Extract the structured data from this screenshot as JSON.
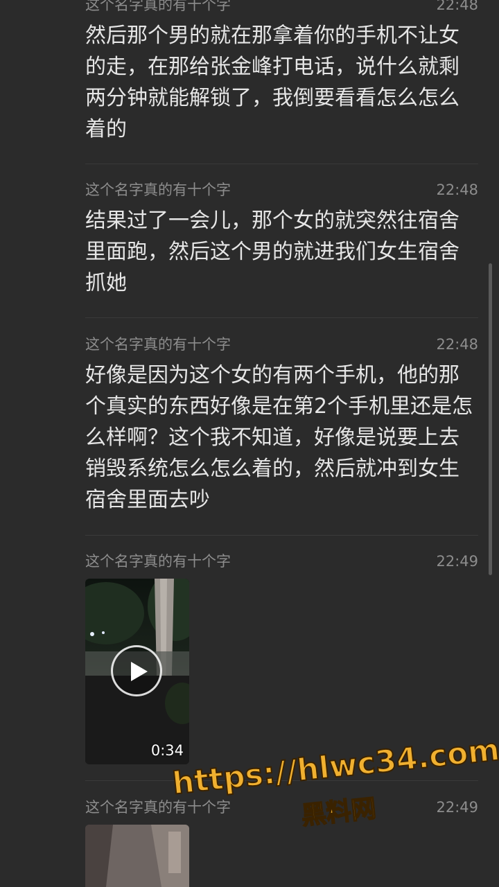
{
  "messages": [
    {
      "sender": "这个名字真的有十个字",
      "time": "22:48",
      "text": "然后那个男的就在那拿着你的手机不让女的走，在那给张金峰打电话，说什么就剩两分钟就能解锁了，我倒要看看怎么怎么着的"
    },
    {
      "sender": "这个名字真的有十个字",
      "time": "22:48",
      "text": "结果过了一会儿，那个女的就突然往宿舍里面跑，然后这个男的就进我们女生宿舍抓她"
    },
    {
      "sender": "这个名字真的有十个字",
      "time": "22:48",
      "text": "好像是因为这个女的有两个手机，他的那个真实的东西好像是在第2个手机里还是怎么样啊？这个我不知道，好像是说要上去销毁系统怎么怎么着的，然后就冲到女生宿舍里面去吵"
    },
    {
      "sender": "这个名字真的有十个字",
      "time": "22:49",
      "video": {
        "duration": "0:34",
        "icon": "play-icon"
      }
    },
    {
      "sender": "这个名字真的有十个字",
      "time": "22:49",
      "video": {
        "icon": "image-thumbnail"
      }
    }
  ],
  "watermark": {
    "url": "https://hlwc34.com",
    "label": "黑料网"
  },
  "colors": {
    "background": "#2b2b2b",
    "meta_text": "#8d8d8d",
    "body_text": "#e6e6e6",
    "watermark": "#f0b030"
  }
}
